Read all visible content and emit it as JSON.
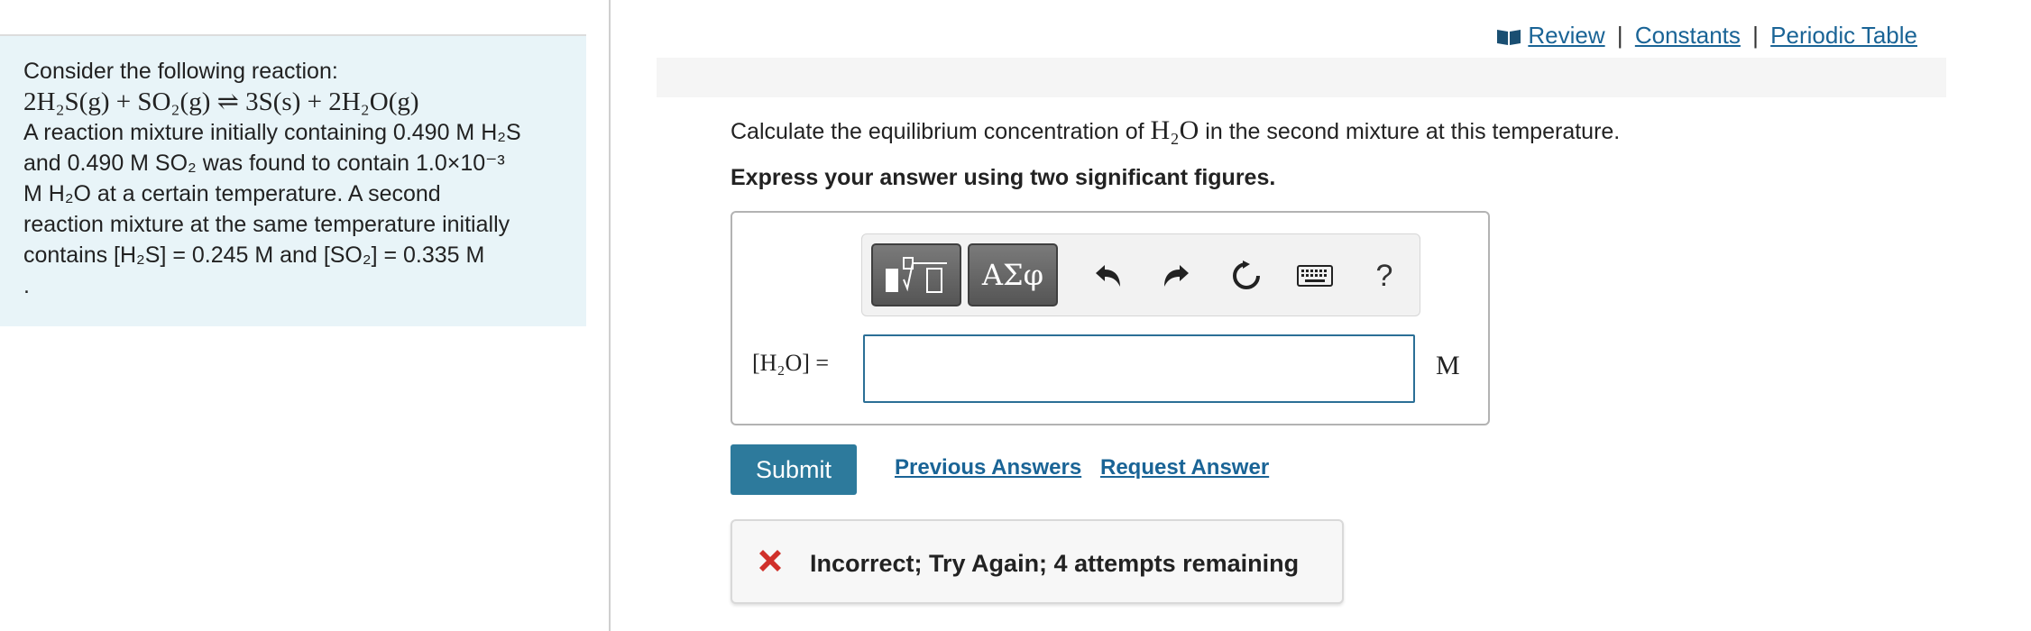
{
  "problem": {
    "line1": "Consider the following reaction:",
    "reaction": "2H₂S(g) + SO₂(g) ⇌ 3S(s) + 2H₂O(g)",
    "line3": "A reaction mixture initially containing 0.490 M H₂S",
    "line4": "and 0.490 M SO₂ was found to contain 1.0×10⁻³",
    "line5": "M H₂O at a certain temperature. A second",
    "line6": "reaction mixture at the same temperature initially",
    "line7": "contains [H₂S] = 0.245 M and [SO₂] = 0.335 M",
    "line8": "."
  },
  "header_links": {
    "review": "Review",
    "constants": "Constants",
    "periodic_table": "Periodic Table",
    "separator": "|"
  },
  "question": {
    "prefix": "Calculate the equilibrium concentration of",
    "species": "H₂O",
    "suffix": "in the second mixture at this temperature."
  },
  "instruction": "Express your answer using two significant figures.",
  "toolbar": {
    "greek_label": "ΑΣφ",
    "help_label": "?",
    "icons": [
      "templates-icon",
      "undo-icon",
      "redo-icon",
      "reset-icon",
      "keyboard-icon",
      "help-icon"
    ]
  },
  "answer": {
    "label": "[H₂O] =",
    "value": "",
    "unit": "M"
  },
  "actions": {
    "submit": "Submit",
    "previous_answers": "Previous Answers",
    "request_answer": "Request Answer"
  },
  "feedback": {
    "text": "Incorrect; Try Again; 4 attempts remaining",
    "color": "#d0302a"
  },
  "colors": {
    "link": "#1a6496",
    "submit_bg": "#2d7a9c",
    "panel_bg": "#e8f4f8",
    "input_border": "#2b6f96"
  }
}
